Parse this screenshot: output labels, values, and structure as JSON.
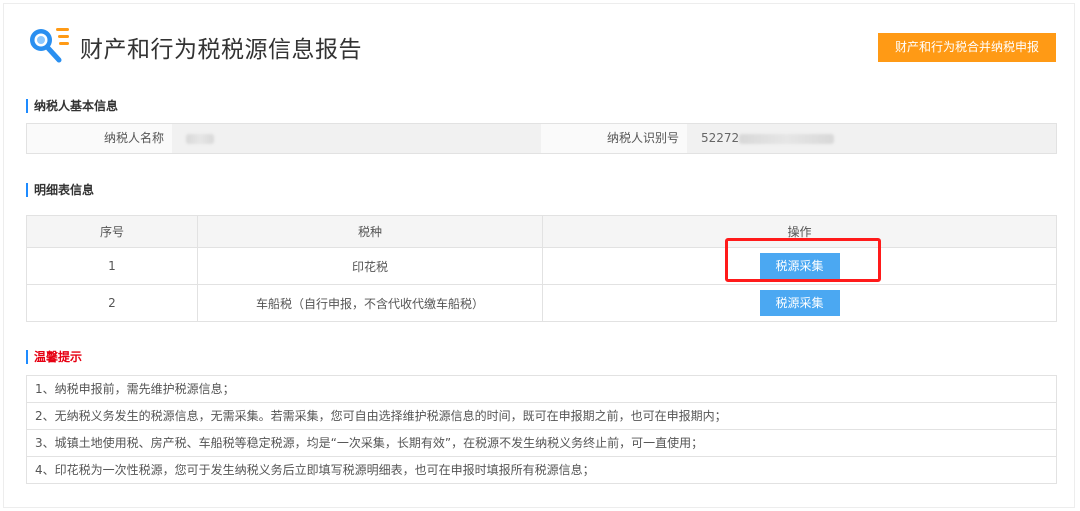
{
  "header": {
    "title": "财产和行为税税源信息报告",
    "combined_declare_button": "财产和行为税合并纳税申报",
    "logo_icon": "search-document-icon"
  },
  "basic_info": {
    "section_title": "纳税人基本信息",
    "name_label": "纳税人名称",
    "name_value": "",
    "id_label": "纳税人识别号",
    "id_value_prefix": "52272"
  },
  "detail": {
    "section_title": "明细表信息",
    "columns": [
      "序号",
      "税种",
      "操作"
    ],
    "rows": [
      {
        "index": "1",
        "tax_type": "印花税",
        "action": "税源采集"
      },
      {
        "index": "2",
        "tax_type": "车船税（自行申报，不含代收代缴车船税）",
        "action": "税源采集"
      }
    ]
  },
  "tips": {
    "section_title": "温馨提示",
    "items": [
      "1、纳税申报前，需先维护税源信息；",
      "2、无纳税义务发生的税源信息，无需采集。若需采集，您可自由选择维护税源信息的时间，既可在申报期之前，也可在申报期内；",
      "3、城镇土地使用税、房产税、车船税等稳定税源，均是“一次采集，长期有效”，在税源不发生纳税义务终止前，可一直使用；",
      "4、印花税为一次性税源，您可于发生纳税义务后立即填写税源明细表，也可在申报时填报所有税源信息；"
    ]
  },
  "colors": {
    "accent_orange": "#ff9a15",
    "button_blue": "#4ba8f2",
    "highlight_red": "#ff1a1a",
    "tips_title_red": "#e60012"
  }
}
